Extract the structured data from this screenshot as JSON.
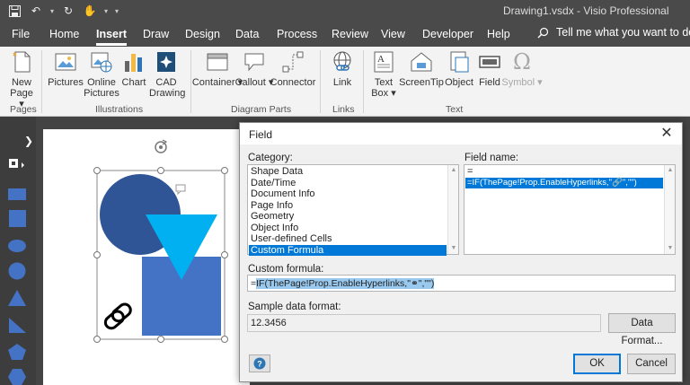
{
  "window": {
    "title": "Drawing1.vsdx  -  Visio Professional"
  },
  "menu": {
    "tabs": [
      "File",
      "Home",
      "Insert",
      "Draw",
      "Design",
      "Data",
      "Process",
      "Review",
      "View",
      "Developer",
      "Help"
    ],
    "active_tab": "Insert",
    "tell_me": "Tell me what you want to do"
  },
  "ribbon": {
    "new_page": "New Page ▾",
    "pictures": "Pictures",
    "online_pictures": "Online Pictures",
    "chart": "Chart",
    "cad_drawing": "CAD Drawing",
    "container": "Container ▾",
    "callout": "Callout ▾",
    "connector": "Connector",
    "link": "Link",
    "text_box": "Text Box ▾",
    "screentip": "ScreenTip",
    "object": "Object",
    "field": "Field",
    "symbol": "Symbol ▾",
    "groups": {
      "pages": "Pages",
      "illustrations": "Illustrations",
      "diagram_parts": "Diagram Parts",
      "links": "Links",
      "text": "Text"
    }
  },
  "dialog": {
    "title": "Field",
    "category_label": "Category:",
    "categories": [
      "Shape Data",
      "Date/Time",
      "Document Info",
      "Page Info",
      "Geometry",
      "Object Info",
      "User-defined Cells",
      "Custom Formula"
    ],
    "selected_category": "Custom Formula",
    "field_name_label": "Field name:",
    "field_names": [
      "=",
      "=IF(ThePage!Prop.EnableHyperlinks,\"🔗\",\"\")"
    ],
    "selected_field": "=IF(ThePage!Prop.EnableHyperlinks,\"🔗\",\"\")",
    "custom_formula_label": "Custom formula:",
    "custom_formula_prefix": "=",
    "custom_formula_value": "IF(ThePage!Prop.EnableHyperlinks,\"⚭\",\"\")",
    "sample_label": "Sample data format:",
    "sample_value": "12.3456",
    "data_format_button": "Data Format...",
    "ok_button": "OK",
    "cancel_button": "Cancel"
  },
  "colors": {
    "accent": "#0078d7",
    "circle": "#2f5597",
    "triangle": "#00b0f0",
    "square": "#4472c4",
    "shape_panel": "#4472c4"
  }
}
